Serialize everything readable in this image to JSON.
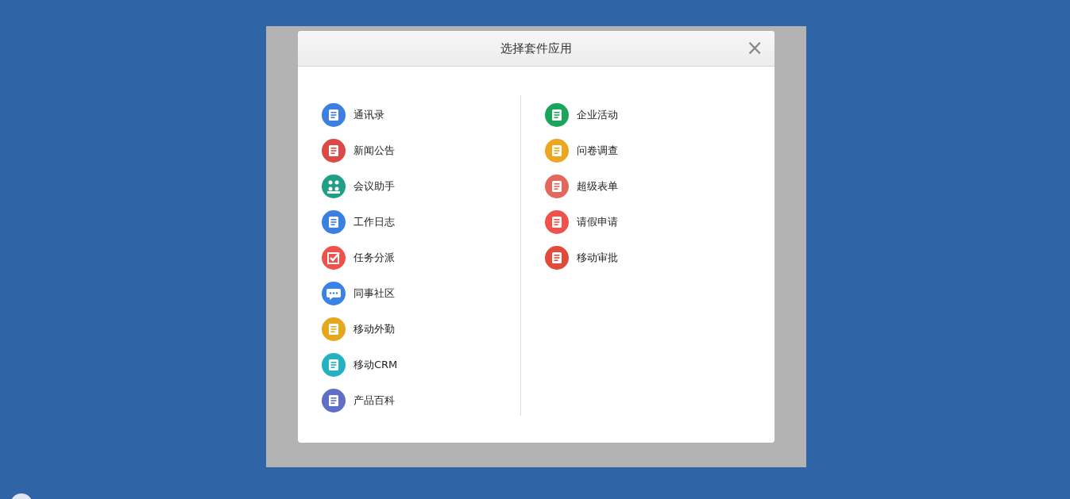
{
  "dialog": {
    "title": "选择套件应用",
    "close": "×"
  },
  "columns": [
    {
      "items": [
        {
          "label": "通讯录",
          "color": "#3b7fe0"
        },
        {
          "label": "新闻公告",
          "color": "#dc4a45"
        },
        {
          "label": "会议助手",
          "color": "#1f9e88"
        },
        {
          "label": "工作日志",
          "color": "#3b7fe0"
        },
        {
          "label": "任务分派",
          "color": "#f0524b"
        },
        {
          "label": "同事社区",
          "color": "#3b82e6"
        },
        {
          "label": "移动外勤",
          "color": "#e5a81c"
        },
        {
          "label": "移动CRM",
          "color": "#25b1c4"
        },
        {
          "label": "产品百科",
          "color": "#5f6fc7"
        }
      ]
    },
    {
      "items": [
        {
          "label": "企业活动",
          "color": "#1aa55a"
        },
        {
          "label": "问卷调查",
          "color": "#eca61f"
        },
        {
          "label": "超级表单",
          "color": "#e4675c"
        },
        {
          "label": "请假申请",
          "color": "#f0524b"
        },
        {
          "label": "移动审批",
          "color": "#e04b3a"
        }
      ]
    }
  ]
}
